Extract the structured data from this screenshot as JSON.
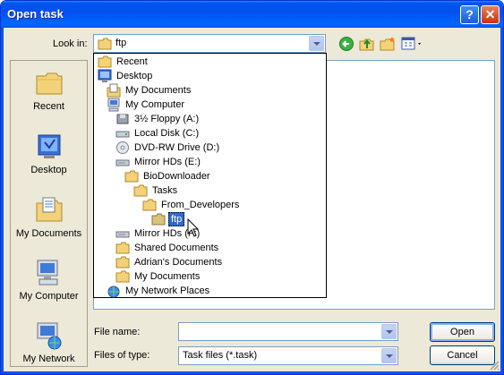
{
  "window": {
    "title": "Open task"
  },
  "titlebar_buttons": {
    "help": "?",
    "close": "✕"
  },
  "look_in": {
    "label": "Look in:",
    "value": "ftp"
  },
  "places": [
    {
      "label": "Recent",
      "icon": "recent-folder-icon"
    },
    {
      "label": "Desktop",
      "icon": "desktop-icon"
    },
    {
      "label": "My Documents",
      "icon": "my-documents-icon"
    },
    {
      "label": "My Computer",
      "icon": "my-computer-icon"
    },
    {
      "label": "My Network",
      "icon": "my-network-icon"
    }
  ],
  "dropdown_items": [
    {
      "label": "Recent",
      "icon": "folder-icon",
      "depth": 0
    },
    {
      "label": "Desktop",
      "icon": "desktop-icon",
      "depth": 0
    },
    {
      "label": "My Documents",
      "icon": "my-documents-icon",
      "depth": 1
    },
    {
      "label": "My Computer",
      "icon": "my-computer-icon",
      "depth": 1
    },
    {
      "label": "3½ Floppy (A:)",
      "icon": "floppy-icon",
      "depth": 2
    },
    {
      "label": "Local Disk (C:)",
      "icon": "hard-disk-icon",
      "depth": 2
    },
    {
      "label": "DVD-RW Drive (D:)",
      "icon": "dvd-drive-icon",
      "depth": 2
    },
    {
      "label": "Mirror HDs (E:)",
      "icon": "drive-icon",
      "depth": 2
    },
    {
      "label": "BioDownloader",
      "icon": "folder-icon",
      "depth": 3
    },
    {
      "label": "Tasks",
      "icon": "folder-icon",
      "depth": 4
    },
    {
      "label": "From_Developers",
      "icon": "folder-icon",
      "depth": 5
    },
    {
      "label": "ftp",
      "icon": "open-folder-icon",
      "depth": 6,
      "selected": true
    },
    {
      "label": "Mirror HDs (F:)",
      "icon": "drive-icon",
      "depth": 2
    },
    {
      "label": "Shared Documents",
      "icon": "folder-icon",
      "depth": 2
    },
    {
      "label": "Adrian's Documents",
      "icon": "folder-icon",
      "depth": 2
    },
    {
      "label": "My Documents",
      "icon": "folder-icon",
      "depth": 2
    },
    {
      "label": "My Network Places",
      "icon": "network-places-icon",
      "depth": 1
    }
  ],
  "file_name": {
    "label": "File name:",
    "value": ""
  },
  "file_type": {
    "label": "Files of type:",
    "value": "Task files (*.task)"
  },
  "buttons": {
    "open": "Open",
    "cancel": "Cancel"
  },
  "colors": {
    "title_bar": "#0054e3",
    "selection": "#316ac5",
    "dialog_bg": "#ece9d8"
  }
}
